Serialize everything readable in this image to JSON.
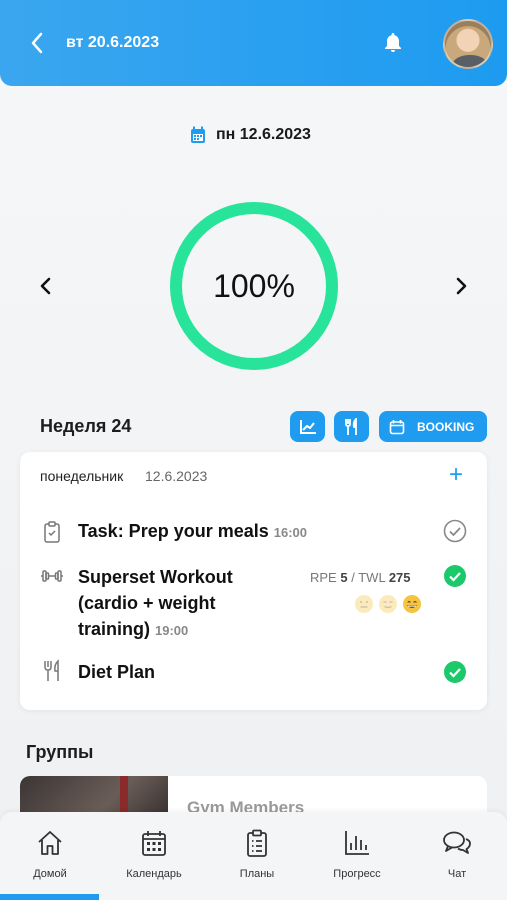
{
  "header": {
    "date": "вт 20.6.2023"
  },
  "selected_date": "пн 12.6.2023",
  "progress": {
    "value": 100,
    "label": "100%"
  },
  "week": {
    "title": "Неделя 24",
    "booking_label": "BOOKING"
  },
  "day_card": {
    "day": "понедельник",
    "date": "12.6.2023",
    "add_label": "+",
    "items": [
      {
        "title": "Task: Prep your meals",
        "time": "16:00",
        "done": false
      },
      {
        "title_lines": [
          "Superset Workout",
          "(cardio + weight",
          "training)"
        ],
        "time": "19:00",
        "done": true
      },
      {
        "title": "Diet Plan",
        "done": true
      }
    ],
    "rpe": {
      "rpe_label": "RPE",
      "rpe_value": "5",
      "sep": "/",
      "twl_label": "TWL",
      "twl_value": "275"
    }
  },
  "groups": {
    "title": "Группы",
    "items": [
      {
        "name": "Gym Members"
      }
    ]
  },
  "tabs": [
    {
      "label": "Домой",
      "icon": "home-icon",
      "active": true
    },
    {
      "label": "Календарь",
      "icon": "calendar-icon"
    },
    {
      "label": "Планы",
      "icon": "clipboard-icon"
    },
    {
      "label": "Прогресс",
      "icon": "bar-chart-icon"
    },
    {
      "label": "Чат",
      "icon": "chat-icon"
    }
  ],
  "colors": {
    "accent": "#1f9cf0",
    "progress": "#28e39a",
    "check": "#1bc86a"
  }
}
